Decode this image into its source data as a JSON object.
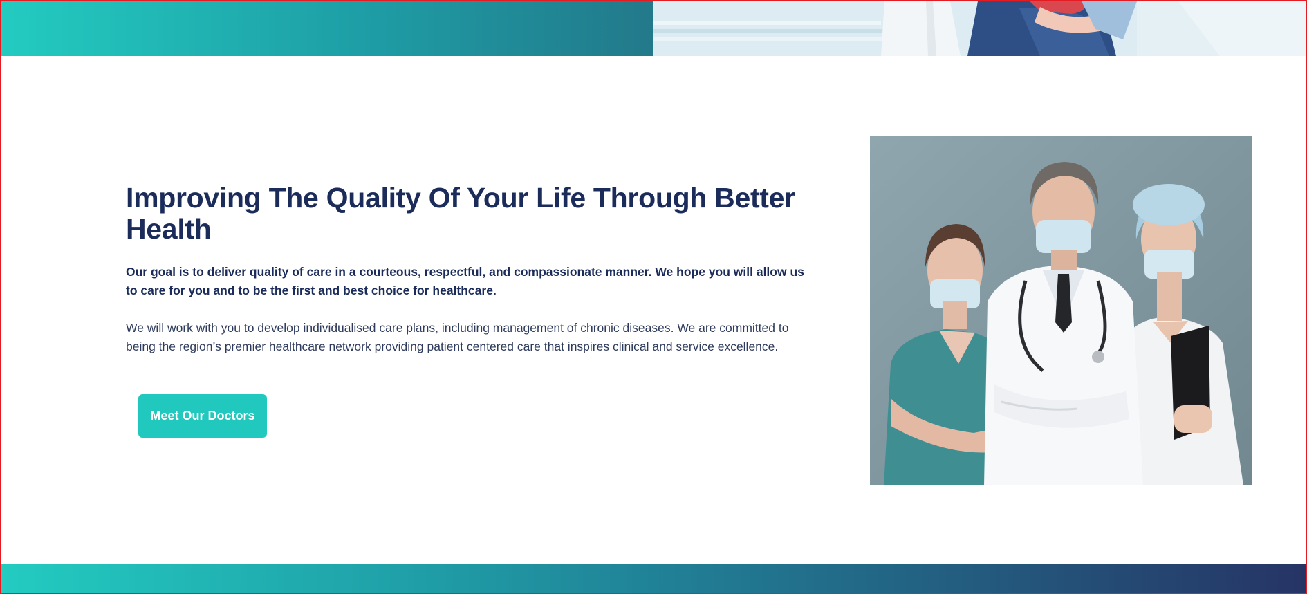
{
  "section": {
    "headline": "Improving The Quality Of Your Life Through Better Health",
    "lead": "Our goal is to deliver quality of care in a courteous, respectful, and compassionate manner. We hope you will allow us to care for you and to be the first and best choice for healthcare.",
    "body": "We will work with you to develop individualised care plans, including management of chronic diseases. We are committed to being the region’s premier healthcare network providing patient centered care that inspires clinical and service excellence.",
    "cta_label": "Meet Our Doctors"
  },
  "colors": {
    "heading": "#1b2c5a",
    "accent": "#20c8bd",
    "gradient_start": "#23cbc0",
    "gradient_end": "#263465"
  }
}
